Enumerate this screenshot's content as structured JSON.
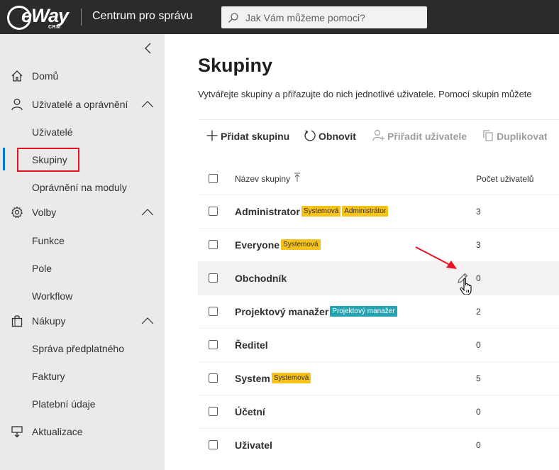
{
  "header": {
    "logo_text": "eWay",
    "logo_sub": "CRM",
    "title": "Centrum pro správu",
    "search_placeholder": "Jak Vám můžeme pomoci?"
  },
  "sidebar": {
    "items": [
      {
        "label": "Domů",
        "icon": "home-icon"
      },
      {
        "label": "Uživatelé a oprávnění",
        "icon": "user-icon",
        "expanded": true,
        "children": [
          "Uživatelé",
          "Skupiny",
          "Oprávnění na moduly"
        ]
      },
      {
        "label": "Volby",
        "icon": "gear-icon",
        "expanded": true,
        "children": [
          "Funkce",
          "Pole",
          "Workflow"
        ]
      },
      {
        "label": "Nákupy",
        "icon": "shopping-bag-icon",
        "expanded": true,
        "children": [
          "Správa předplatného",
          "Faktury",
          "Platební údaje"
        ]
      },
      {
        "label": "Aktualizace",
        "icon": "update-icon"
      }
    ],
    "selected": "Skupiny"
  },
  "main": {
    "title": "Skupiny",
    "description": "Vytvářejte skupiny a přiřazujte do nich jednotlivé uživatele. Pomocí skupin můžete",
    "toolbar": {
      "add_label": "Přidat skupinu",
      "refresh_label": "Obnovit",
      "assign_label": "Přiřadit uživatele",
      "duplicate_label": "Duplikovat"
    },
    "table": {
      "col_name": "Název skupiny",
      "col_count": "Počet uživatelů",
      "rows": [
        {
          "name": "Administrator",
          "badges": [
            {
              "text": "Systemová",
              "color": "#f7c21a"
            },
            {
              "text": "Administrátor",
              "color": "#f7c21a"
            }
          ],
          "count": "3"
        },
        {
          "name": "Everyone",
          "badges": [
            {
              "text": "Systemová",
              "color": "#f7c21a"
            }
          ],
          "count": "3"
        },
        {
          "name": "Obchodník",
          "badges": [],
          "count": "0"
        },
        {
          "name": "Projektový manažer",
          "badges": [
            {
              "text": "Projektový manažer",
              "color": "#24a4b3"
            }
          ],
          "count": "2"
        },
        {
          "name": "Ředitel",
          "badges": [],
          "count": "0"
        },
        {
          "name": "System",
          "badges": [
            {
              "text": "Systemová",
              "color": "#f7c21a"
            }
          ],
          "count": "5"
        },
        {
          "name": "Účetní",
          "badges": [],
          "count": "0"
        },
        {
          "name": "Uživatel",
          "badges": [],
          "count": "0"
        }
      ],
      "hovered_row": "Obchodník"
    }
  },
  "colors": {
    "header_bg": "#2b2b2b",
    "sidebar_bg": "#eaeaea",
    "accent": "#0078d4",
    "highlight_red": "#e81123",
    "badge_yellow": "#f7c21a",
    "badge_teal": "#24a4b3"
  }
}
